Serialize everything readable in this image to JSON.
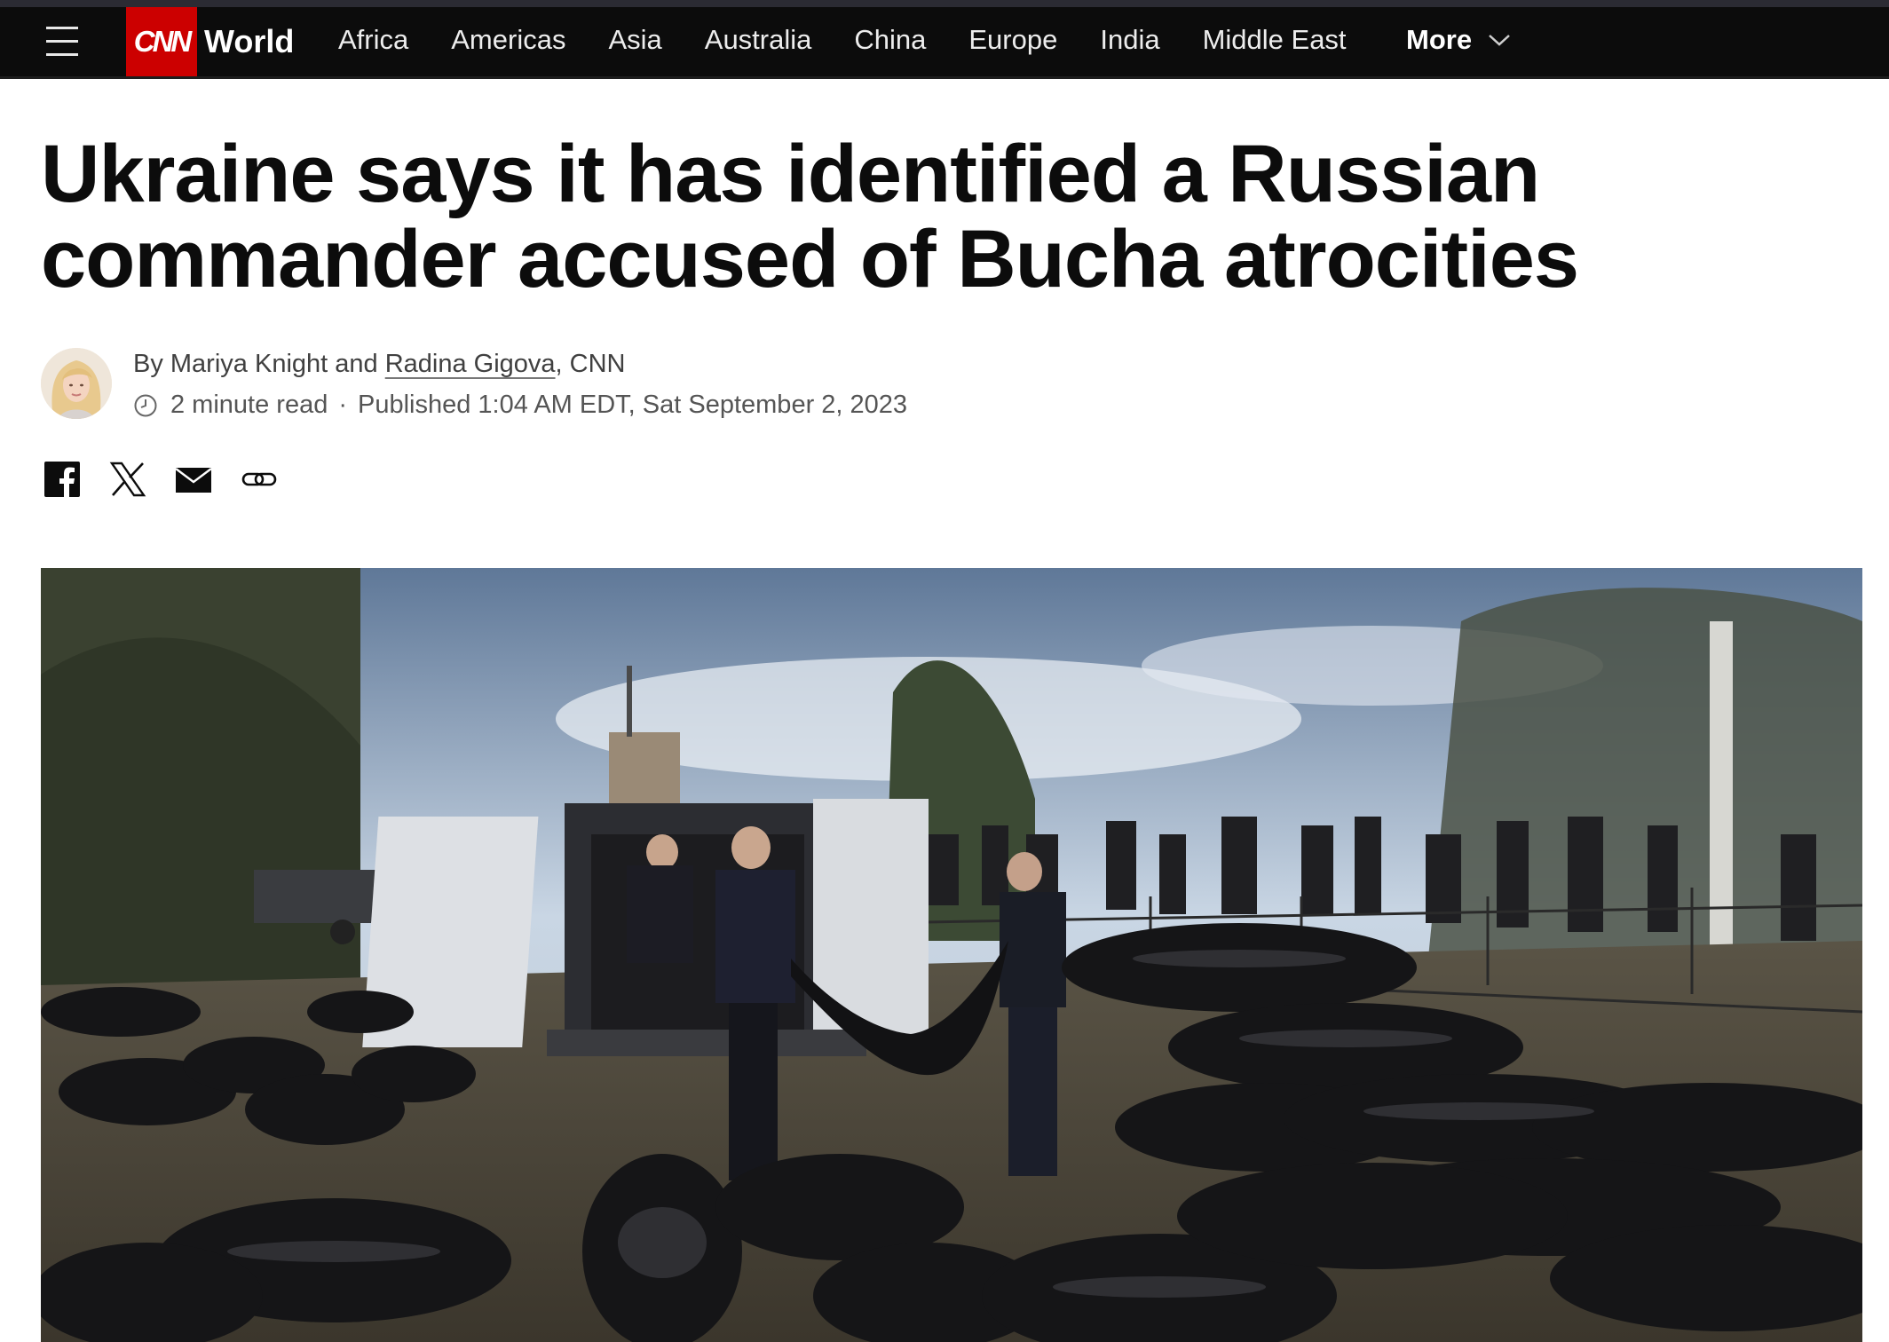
{
  "nav": {
    "logo_text": "CNN",
    "section": "World",
    "links": [
      "Africa",
      "Americas",
      "Asia",
      "Australia",
      "China",
      "Europe",
      "India",
      "Middle East"
    ],
    "more_label": "More",
    "colors": {
      "bar": "#0c0c0c",
      "logo": "#cc0000"
    }
  },
  "article": {
    "headline": "Ukraine says it has identified a Russian commander accused of Bucha atrocities",
    "byline_prefix": "By Mariya Knight and ",
    "byline_link": "Radina Gigova",
    "byline_suffix": ", CNN",
    "read_time": "2 minute read",
    "separator": "·",
    "published": "Published 1:04 AM EDT, Sat September 2, 2023"
  },
  "share": {
    "icons": [
      "facebook-icon",
      "x-icon",
      "email-icon",
      "link-icon"
    ]
  },
  "hero_image": {
    "subject": "cemetery-body-bags-van-photo"
  }
}
